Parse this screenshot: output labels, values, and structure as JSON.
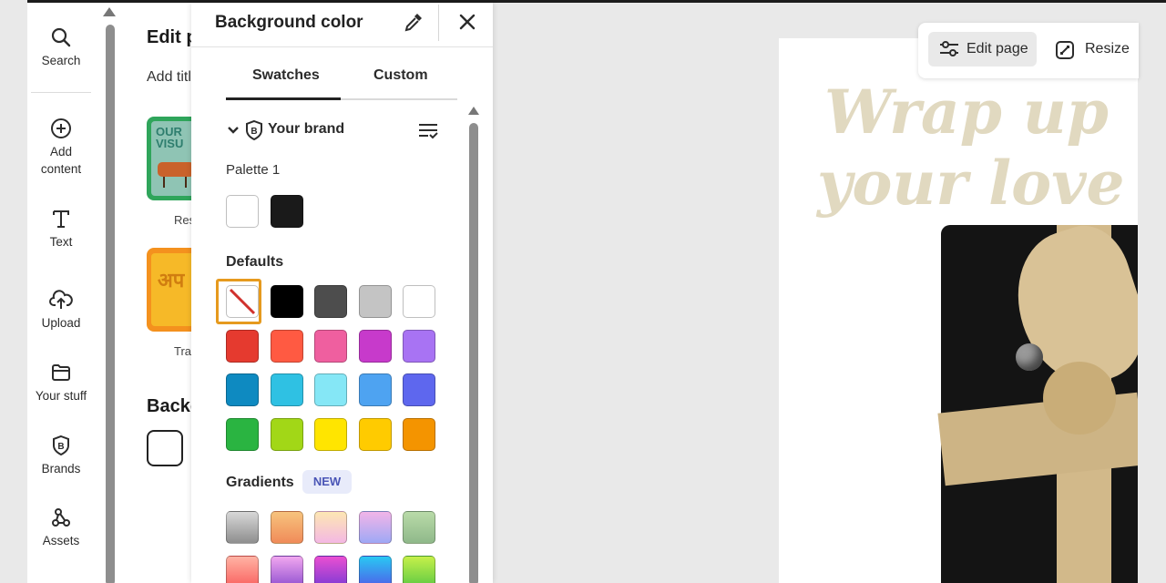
{
  "rail": {
    "items": [
      {
        "label": "Search",
        "icon": "search-icon"
      },
      {
        "label": "Add\ncontent",
        "icon": "plus-circle-icon"
      },
      {
        "label": "Text",
        "icon": "text-icon"
      },
      {
        "label": "Upload",
        "icon": "cloud-upload-icon"
      },
      {
        "label": "Your stuff",
        "icon": "folder-icon"
      },
      {
        "label": "Brands",
        "icon": "brand-icon"
      },
      {
        "label": "Assets",
        "icon": "assets-icon"
      }
    ]
  },
  "edit_panel": {
    "title": "Edit p",
    "subtitle": "Add titl",
    "thumb1_text": "OUR\nVISU",
    "thumb1_label": "Res",
    "thumb2_text": "अप",
    "thumb2_label": "Trans",
    "bg_heading": "Backg"
  },
  "bg_panel": {
    "title": "Background color",
    "tabs": {
      "swatches": "Swatches",
      "custom": "Custom"
    },
    "brand_section": "Your brand",
    "palette_label": "Palette 1",
    "palette_colors": [
      "#ffffff",
      "#1a1a1a"
    ],
    "defaults_heading": "Defaults",
    "defaults_colors": [
      [
        "none",
        "#000000",
        "#4d4d4d",
        "#c4c4c4",
        "#ffffff"
      ],
      [
        "#e53a2f",
        "#ff5a42",
        "#ef5f9f",
        "#c73acb",
        "#a873f3"
      ],
      [
        "#0e8ac1",
        "#2fc1e3",
        "#85e7f6",
        "#4ea3f1",
        "#5e67ee"
      ],
      [
        "#2ab441",
        "#a2d717",
        "#ffe500",
        "#ffcb00",
        "#f49400"
      ]
    ],
    "gradients_heading": "Gradients",
    "new_badge": "NEW",
    "gradient_colors": [
      [
        "linear-gradient(#d8d8d8,#8e8e8e)",
        "linear-gradient(#f7c37d,#f08b59)",
        "linear-gradient(#fde7b3,#f4b8e3)",
        "linear-gradient(#f2b5e8,#9ea8f5)",
        "linear-gradient(#b9dba8,#8fb98a)"
      ],
      [
        "linear-gradient(#ffb3a4,#f9605e)",
        "linear-gradient(#f1a7ef,#8f4fd0)",
        "linear-gradient(#ea4fd2,#7b3ad4)",
        "linear-gradient(#29c8f3,#4f5ee9)",
        "linear-gradient(#c6f04a,#5dc943)"
      ]
    ]
  },
  "canvas": {
    "line1": "Wrap up",
    "line2": "your love"
  },
  "toolbar": {
    "edit_page": "Edit page",
    "resize": "Resize"
  }
}
